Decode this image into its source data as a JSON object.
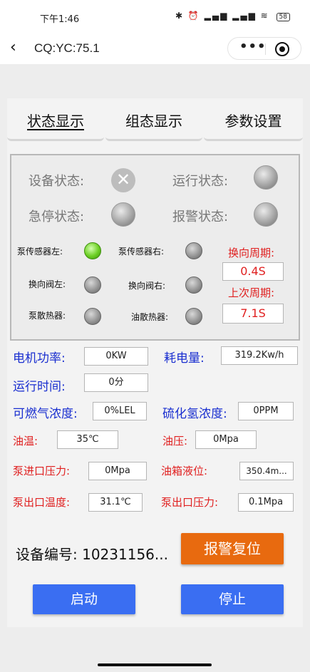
{
  "statusbar": {
    "time": "下午1:46",
    "signal": "✱ ⏰ ▂▄▆ ▂▄▆ ≋",
    "battery": "58"
  },
  "nav": {
    "back": "‹",
    "title": "CQ:YC:75.1",
    "more": "•••"
  },
  "tabs": [
    {
      "label": "状态显示",
      "active": true
    },
    {
      "label": "组态显示",
      "active": false
    },
    {
      "label": "参数设置",
      "active": false
    }
  ],
  "status": {
    "device_status": "设备状态:",
    "run_status": "运行状态:",
    "estop_status": "急停状态:",
    "alarm_status": "报警状态:",
    "pump_sensor_left": "泵传感器左:",
    "pump_sensor_right": "泵传感器右:",
    "valve_left": "换向阀左:",
    "valve_right": "换向阀右:",
    "pump_radiator": "泵散热器:",
    "oil_radiator": "油散热器:",
    "cycle_label": "换向周期:",
    "cycle_value": "0.4S",
    "last_cycle_label": "上次周期:",
    "last_cycle_value": "7.1S",
    "x_mark": "✕"
  },
  "params": {
    "motor_power_label": "电机功率:",
    "motor_power": "0KW",
    "energy_label": "耗电量:",
    "energy": "319.2Kw/h",
    "run_time_label": "运行时间:",
    "run_time": "0分",
    "gas_label": "可燃气浓度:",
    "gas": "0%LEL",
    "h2s_label": "硫化氢浓度:",
    "h2s": "0PPM",
    "oil_temp_label": "油温:",
    "oil_temp": "35℃",
    "oil_pressure_label": "油压:",
    "oil_pressure": "0Mpa",
    "pump_in_pressure_label": "泵进口压力:",
    "pump_in_pressure": "0Mpa",
    "tank_level_label": "油箱液位:",
    "tank_level": "350.4m...",
    "pump_out_temp_label": "泵出口温度:",
    "pump_out_temp": "31.1℃",
    "pump_out_pressure_label": "泵出口压力:",
    "pump_out_pressure": "0.1Mpa"
  },
  "device": {
    "label": "设备编号:",
    "number": "10231156..."
  },
  "buttons": {
    "reset": "报警复位",
    "start": "启动",
    "stop": "停止"
  }
}
